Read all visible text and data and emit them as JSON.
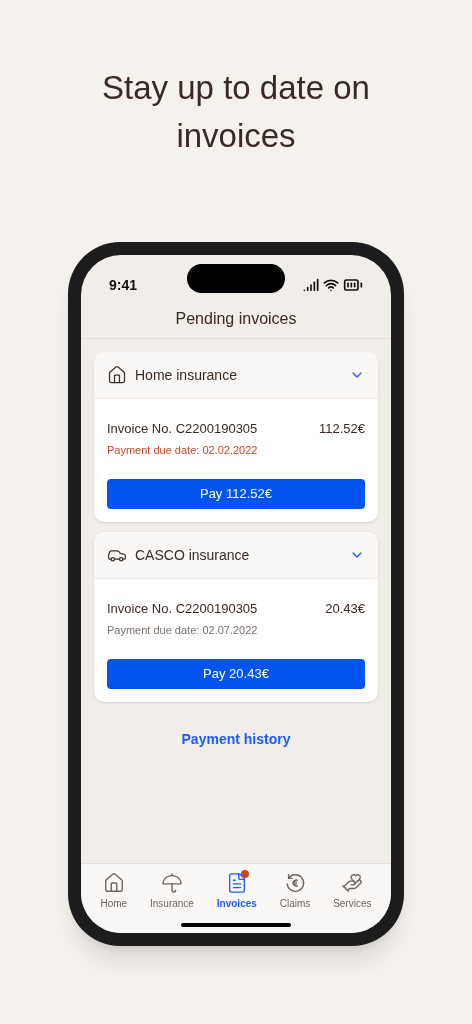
{
  "headline": "Stay up to date on invoices",
  "status_bar": {
    "time": "9:41"
  },
  "screen_title": "Pending invoices",
  "policies": [
    {
      "kind": "home",
      "name": "Home insurance",
      "expanded": true,
      "invoice": "Invoice No. C2200190305",
      "amount": "112.52€",
      "due": "Payment due date: 02.02.2022",
      "overdue": true,
      "pay_label": "Pay 112.52€"
    },
    {
      "kind": "car",
      "name": "CASCO insurance",
      "expanded": true,
      "invoice": "Invoice No. C2200190305",
      "amount": "20.43€",
      "due": "Payment due date: 02.07.2022",
      "overdue": false,
      "pay_label": "Pay 20.43€"
    }
  ],
  "history_link": "Payment history",
  "tabs": [
    {
      "kind": "home",
      "label": "Home",
      "selected": false,
      "badge": false
    },
    {
      "kind": "insurance",
      "label": "Insurance",
      "selected": false,
      "badge": false
    },
    {
      "kind": "invoices",
      "label": "Invoices",
      "selected": true,
      "badge": true
    },
    {
      "kind": "claims",
      "label": "Claims",
      "selected": false,
      "badge": false
    },
    {
      "kind": "services",
      "label": "Services",
      "selected": false,
      "badge": false
    }
  ]
}
